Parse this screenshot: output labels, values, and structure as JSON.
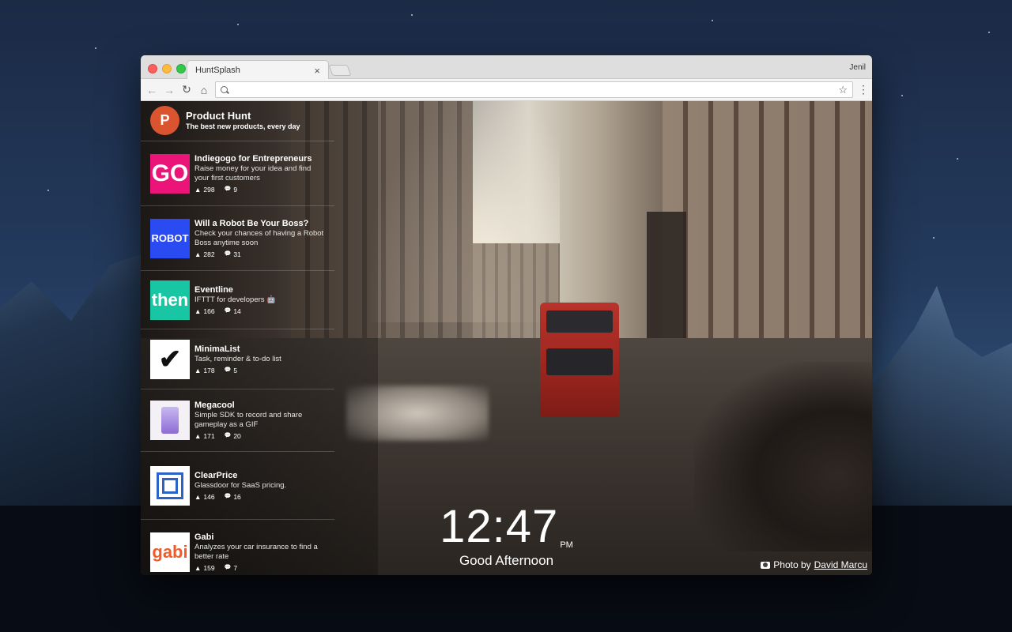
{
  "browser": {
    "tab_title": "HuntSplash",
    "tab_close": "×",
    "profile_name": "Jenil",
    "address_value": "",
    "back_glyph": "←",
    "forward_glyph": "→",
    "reload_glyph": "↻",
    "home_glyph": "⌂",
    "star_glyph": "☆",
    "menu_glyph": "⋮"
  },
  "product_hunt": {
    "logo_letter": "P",
    "title": "Product Hunt",
    "subtitle": "The best new products, every day",
    "products": [
      {
        "name": "Indiegogo for Entrepreneurs",
        "description": "Raise money for your idea and find your first customers",
        "votes": "298",
        "comments": "9",
        "thumb_text": "GO",
        "thumb_bg": "#eb1478",
        "thumb_color": "#ffffff"
      },
      {
        "name": "Will a Robot Be Your Boss?",
        "description": "Check your chances of having a Robot Boss anytime soon",
        "votes": "282",
        "comments": "31",
        "thumb_text": "ROBOT",
        "thumb_bg": "#2b4bf2",
        "thumb_color": "#ffffff"
      },
      {
        "name": "Eventline",
        "description": "IFTTT for developers 🤖",
        "votes": "166",
        "comments": "14",
        "thumb_text": "then",
        "thumb_bg": "#19c6a4",
        "thumb_color": "#ffffff"
      },
      {
        "name": "MinimaList",
        "description": "Task, reminder & to-do list",
        "votes": "178",
        "comments": "5",
        "thumb_text": "✔",
        "thumb_bg": "#ffffff",
        "thumb_color": "#111111"
      },
      {
        "name": "Megacool",
        "description": "Simple SDK to record and share gameplay as a GIF",
        "votes": "171",
        "comments": "20",
        "thumb_text": "",
        "thumb_bg": "#f3f1f6",
        "thumb_color": "#8d6bd4"
      },
      {
        "name": "ClearPrice",
        "description": "Glassdoor for SaaS pricing.",
        "votes": "146",
        "comments": "16",
        "thumb_text": "",
        "thumb_bg": "#ffffff",
        "thumb_color": "#2c63c7"
      },
      {
        "name": "Gabi",
        "description": "Analyzes your car insurance to find a better rate",
        "votes": "159",
        "comments": "7",
        "thumb_text": "gabi",
        "thumb_bg": "#ffffff",
        "thumb_color": "#f15a29"
      }
    ],
    "vote_icon": "▲",
    "comment_icon": "💬"
  },
  "clock": {
    "time": "12:47",
    "ampm": "PM",
    "greeting": "Good Afternoon"
  },
  "credit": {
    "prefix": "Photo by",
    "author": "David Marcu"
  }
}
